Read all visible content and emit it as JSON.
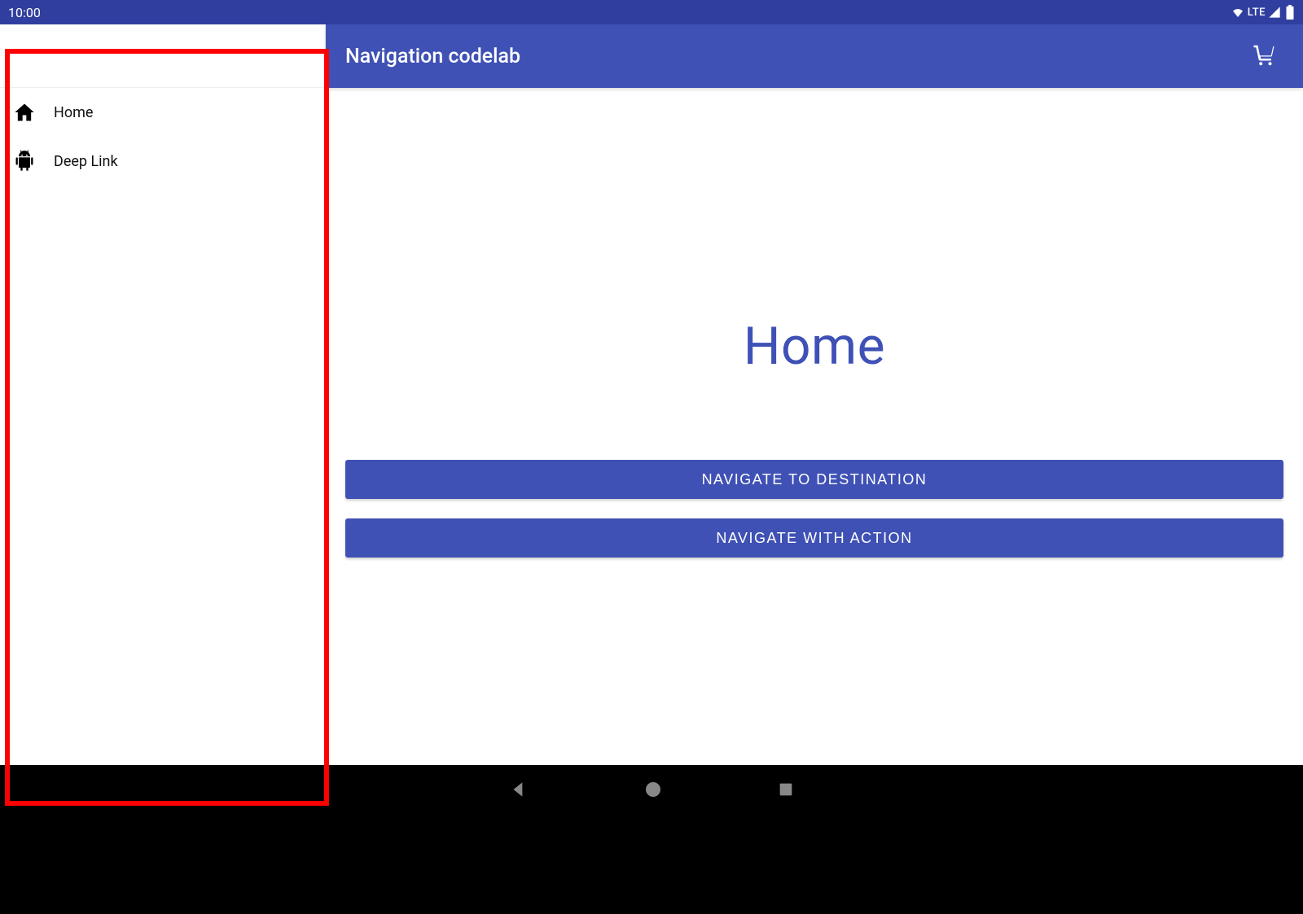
{
  "statusbar": {
    "time": "10:00",
    "network_label": "LTE"
  },
  "appbar": {
    "title": "Navigation codelab"
  },
  "drawer": {
    "items": [
      {
        "label": "Home",
        "icon": "home-icon"
      },
      {
        "label": "Deep Link",
        "icon": "android-icon"
      }
    ]
  },
  "main": {
    "page_title": "Home",
    "buttons": [
      "NAVIGATE TO DESTINATION",
      "NAVIGATE WITH ACTION"
    ]
  },
  "colors": {
    "primary": "#3F51B5",
    "primary_dark": "#303F9F",
    "highlight": "#FF0000"
  }
}
